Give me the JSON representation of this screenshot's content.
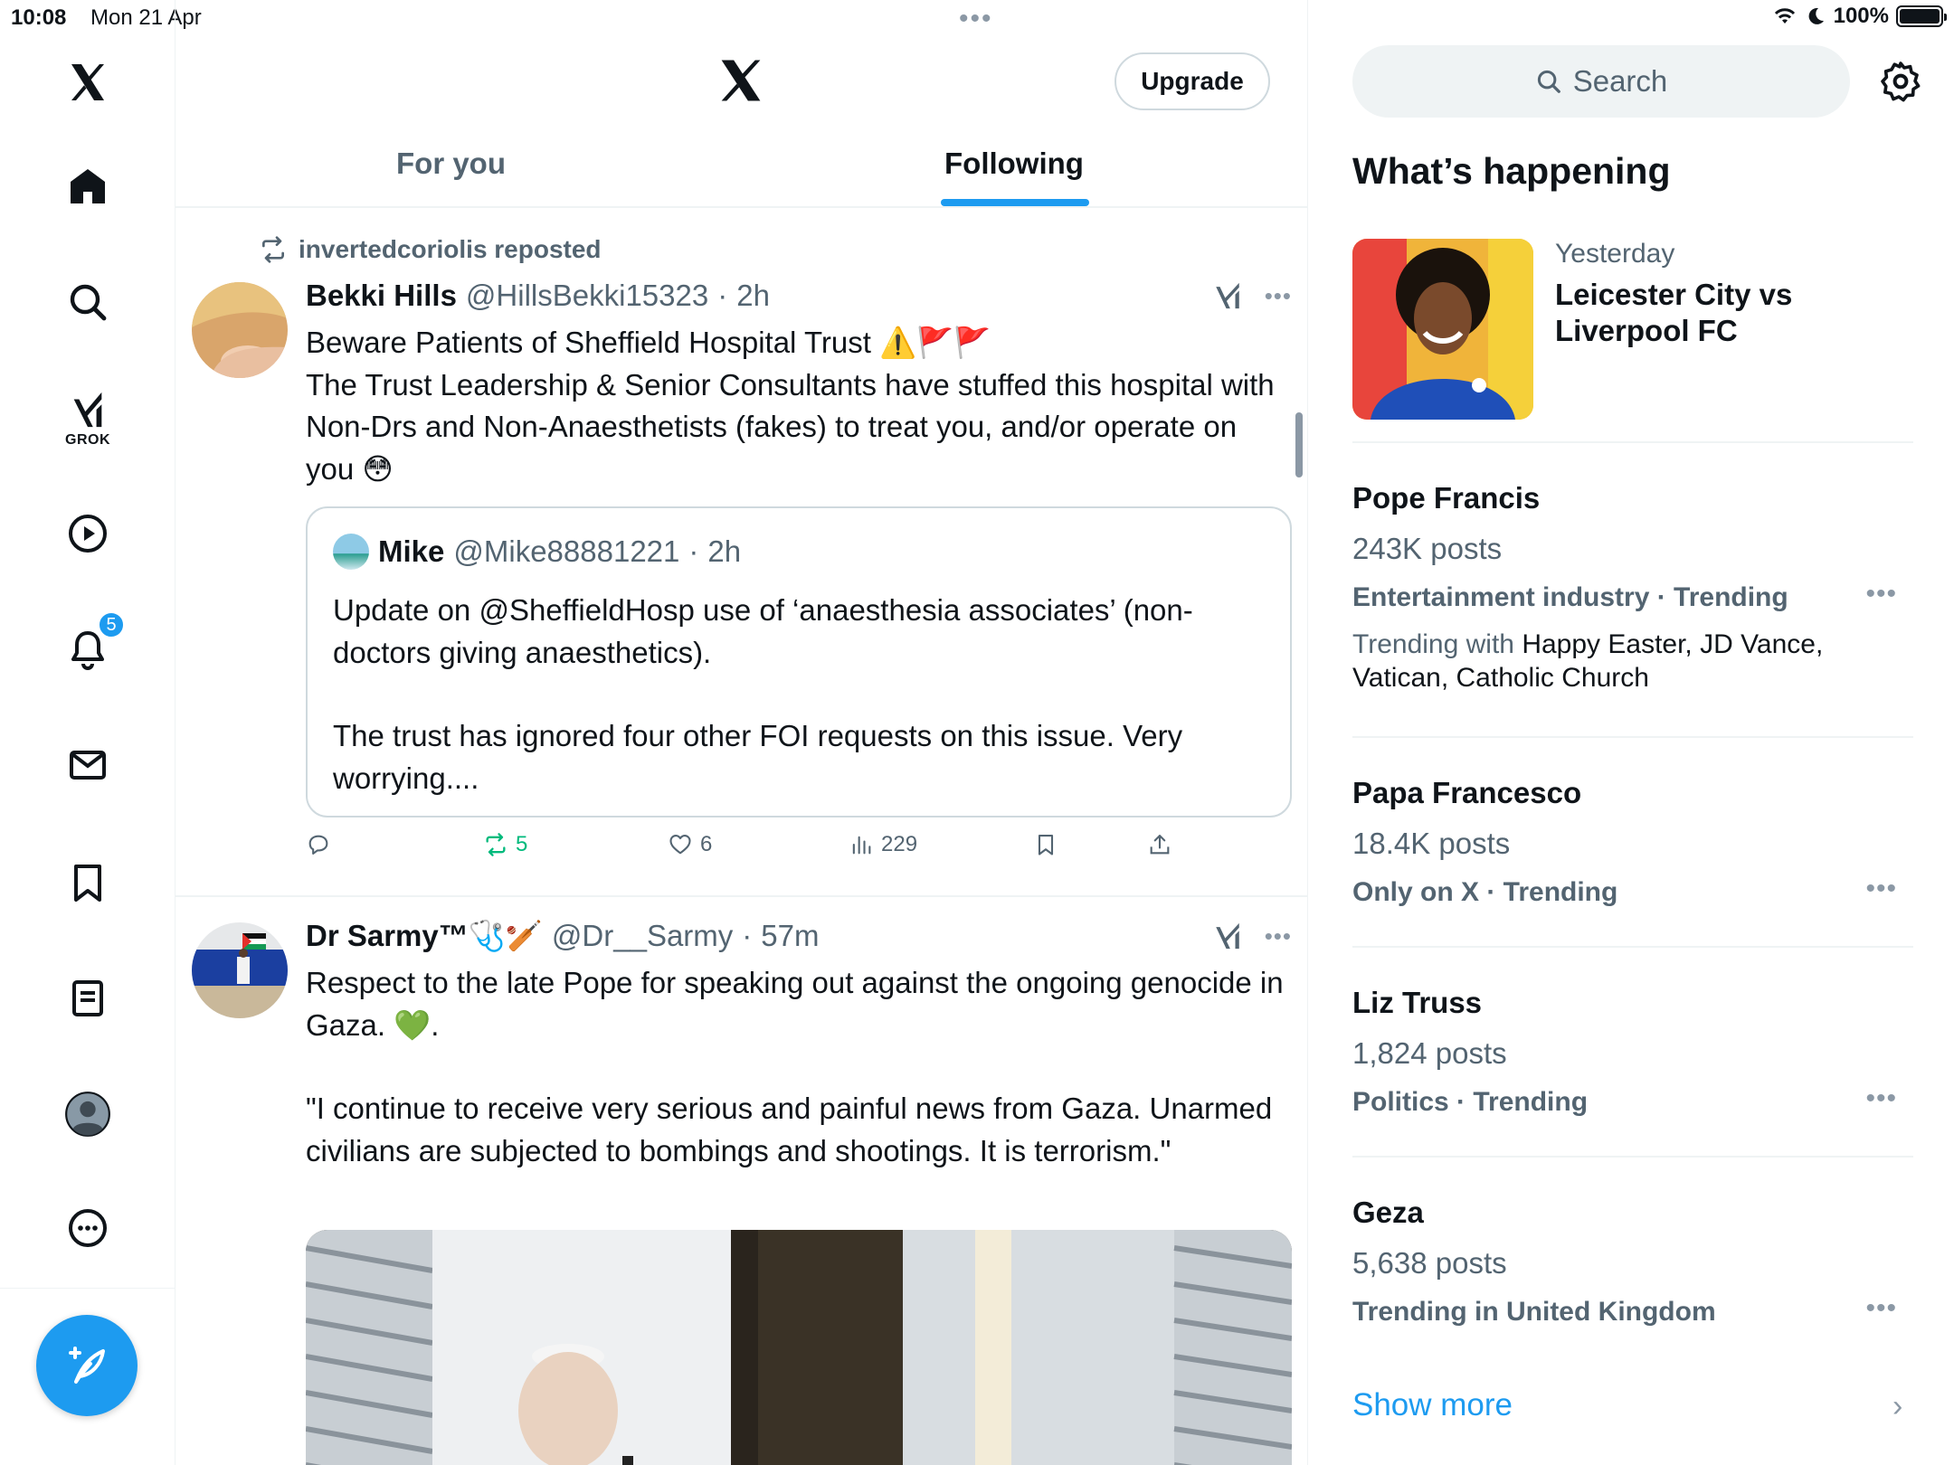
{
  "status_bar": {
    "time": "10:08",
    "date": "Mon 21 Apr",
    "battery": "100%",
    "battery_level": 1.0
  },
  "nav": {
    "grok_label": "GROK",
    "notifications_badge": "5"
  },
  "header": {
    "upgrade_label": "Upgrade",
    "tabs": [
      {
        "label": "For you"
      },
      {
        "label": "Following"
      }
    ],
    "active_tab": "Following"
  },
  "posts": [
    {
      "repost_line": "invertedcoriolis reposted",
      "name": "Bekki Hills",
      "handle": "@HillsBekki15323",
      "separator": "·",
      "time": "2h",
      "text_line1": "Beware Patients of Sheffield Hospital Trust ⚠️🚩🚩",
      "text_line2": "The Trust Leadership & Senior Consultants have stuffed this hospital with Non-Drs and Non-Anaesthetists (fakes) to treat you, and/or operate on you 😳",
      "quote": {
        "name": "Mike",
        "handle": "@Mike88881221",
        "separator": "·",
        "time": "2h",
        "text_p1": "Update on @SheffieldHosp use of ‘anaesthesia associates’ (non-doctors giving anaesthetics).",
        "text_p2": "The trust has ignored four other FOI requests on this issue. Very worrying...."
      },
      "actions": {
        "retweets": "5",
        "likes": "6",
        "views": "229"
      }
    },
    {
      "name": "Dr Sarmy™🩺🏏",
      "handle": "@Dr__Sarmy",
      "separator": "·",
      "time": "57m",
      "text_p1": "Respect to the late Pope for speaking out against the ongoing genocide in Gaza. 💚.",
      "text_p2": "\"I continue to receive very serious and painful news from Gaza. Unarmed civilians are subjected to bombings and shootings. It is terrorism.\""
    }
  ],
  "sidebar": {
    "search_placeholder": "Search",
    "whats_happening": "What’s happening",
    "feature": {
      "meta": "Yesterday",
      "title": "Leicester City vs Liverpool FC"
    },
    "trends": [
      {
        "title": "Pope Francis",
        "count": "243K posts",
        "category": "Entertainment industry · Trending",
        "with_label": "Trending with",
        "with_topics": "Happy Easter, JD Vance, Vatican, Catholic Church"
      },
      {
        "title": "Papa Francesco",
        "count": "18.4K posts",
        "category": "Only on X · Trending"
      },
      {
        "title": "Liz Truss",
        "count": "1,824 posts",
        "category": "Politics · Trending"
      },
      {
        "title": "Geza",
        "count": "5,638 posts",
        "category": "Trending in United Kingdom"
      }
    ],
    "show_more": "Show more"
  },
  "colors": {
    "accent": "#1d9bf0",
    "text": "#0f1419",
    "muted": "#536471",
    "retweet": "#00ba7c"
  },
  "icons": [
    "x-logo-icon",
    "home-icon",
    "search-icon",
    "grok-icon",
    "video-icon",
    "bell-icon",
    "mail-icon",
    "bookmark-icon",
    "lists-icon",
    "profile-icon",
    "more-icon",
    "compose-icon",
    "repost-icon",
    "reply-icon",
    "like-icon",
    "views-icon",
    "share-icon",
    "gear-icon",
    "ellipsis-icon",
    "chevron-right-icon"
  ]
}
